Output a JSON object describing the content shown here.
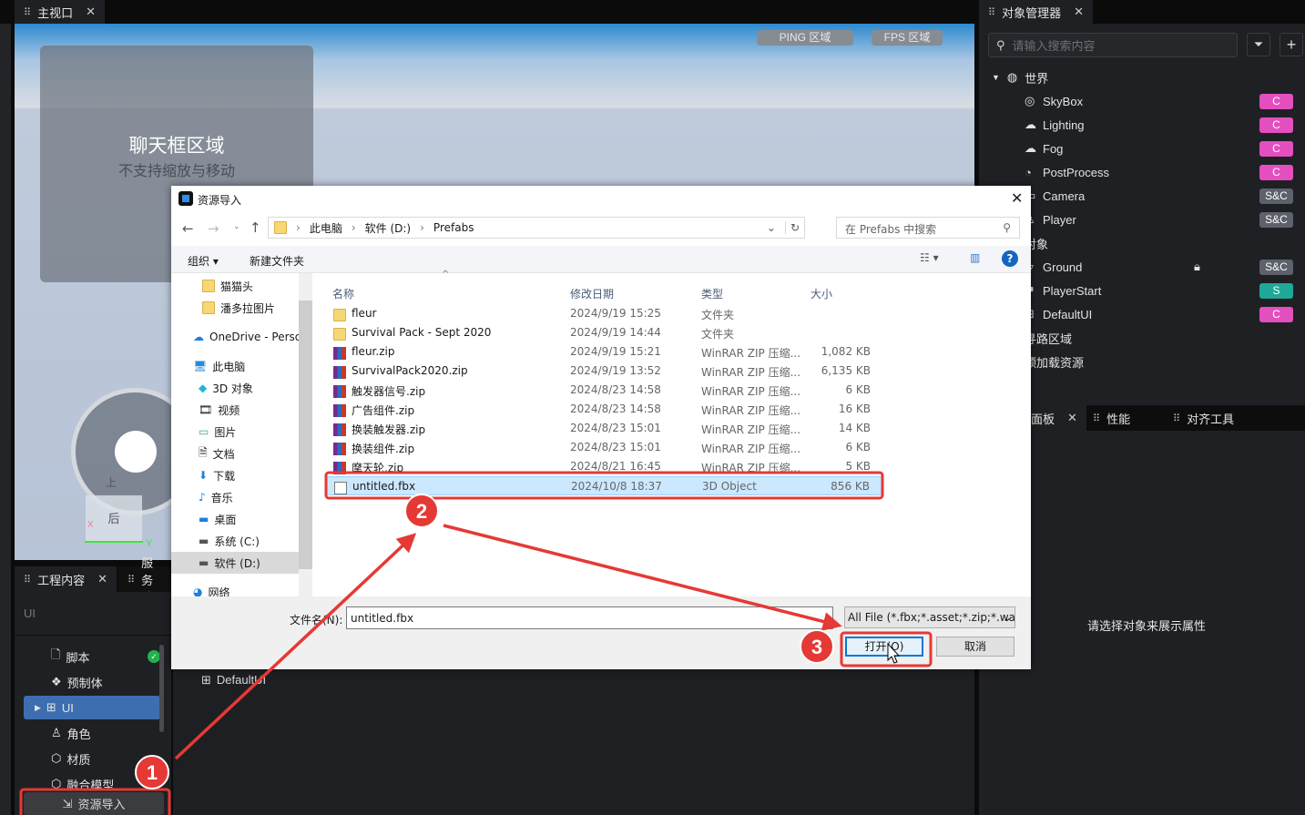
{
  "main_tab": {
    "label": "主视口"
  },
  "viewport": {
    "chat_title": "聊天框区域",
    "chat_subtitle": "不支持缩放与移动",
    "ping": "PING 区域",
    "fps": "FPS 区域",
    "joystick_up": "上",
    "joystick_back": "后",
    "axis_x": "X",
    "axis_y": "Y"
  },
  "left_panel": {
    "tabs": [
      "工程内容",
      "服务端"
    ],
    "breadcrumb": "UI",
    "items": [
      {
        "label": "脚本",
        "icon": "file-icon",
        "status": "check"
      },
      {
        "label": "预制体",
        "icon": "prefab-icon"
      },
      {
        "label": "UI",
        "icon": "ui-icon",
        "selected": true
      },
      {
        "label": "角色",
        "icon": "character-icon"
      },
      {
        "label": "材质",
        "icon": "cube-icon"
      },
      {
        "label": "融合模型",
        "icon": "model-icon"
      }
    ],
    "import_button": "资源导入",
    "content_item": "DefaultUI"
  },
  "right_panel": {
    "tab": "对象管理器",
    "search_placeholder": "请输入搜索内容",
    "world": "世界",
    "tree": [
      {
        "label": "SkyBox",
        "tag": "C"
      },
      {
        "label": "Lighting",
        "tag": "C"
      },
      {
        "label": "Fog",
        "tag": "C"
      },
      {
        "label": "PostProcess",
        "tag": "C"
      },
      {
        "label": "Camera",
        "tag": "S&C"
      },
      {
        "label": "Player",
        "tag": "S&C"
      },
      {
        "label": "对象",
        "group": true
      },
      {
        "label": "Ground",
        "tag": "S&C",
        "locked": true
      },
      {
        "label": "PlayerStart",
        "tag": "S"
      },
      {
        "label": "DefaultUI",
        "tag": "C"
      },
      {
        "label": "寻路区域",
        "group": true
      },
      {
        "label": "预加载资源",
        "group": true
      }
    ],
    "bottom_tabs": [
      "面板",
      "性能",
      "对齐工具"
    ],
    "empty_text": "请选择对象来展示属性"
  },
  "tag_colors": {
    "C": "#e44fbf",
    "S&C": "#5c616b",
    "S": "#1fa898"
  },
  "dialog": {
    "title": "资源导入",
    "path": [
      "此电脑",
      "软件 (D:)",
      "Prefabs"
    ],
    "search_placeholder": "在 Prefabs 中搜索",
    "organize": "组织",
    "new_folder": "新建文件夹",
    "nav": [
      {
        "label": "猫猫头",
        "icon": "folder"
      },
      {
        "label": "潘多拉图片",
        "icon": "folder"
      },
      {
        "label": "OneDrive - Personal",
        "icon": "cloud"
      },
      {
        "label": "此电脑",
        "icon": "pc"
      },
      {
        "label": "3D 对象",
        "icon": "3d"
      },
      {
        "label": "视频",
        "icon": "video"
      },
      {
        "label": "图片",
        "icon": "picture"
      },
      {
        "label": "文档",
        "icon": "doc"
      },
      {
        "label": "下载",
        "icon": "download"
      },
      {
        "label": "音乐",
        "icon": "music"
      },
      {
        "label": "桌面",
        "icon": "desktop"
      },
      {
        "label": "系统 (C:)",
        "icon": "drive"
      },
      {
        "label": "软件 (D:)",
        "icon": "drive",
        "selected": true
      },
      {
        "label": "网络",
        "icon": "network"
      }
    ],
    "columns": [
      "名称",
      "修改日期",
      "类型",
      "大小"
    ],
    "files": [
      {
        "name": "fleur",
        "date": "2024/9/19 15:25",
        "type": "文件夹",
        "size": "",
        "icon": "folder"
      },
      {
        "name": "Survival Pack - Sept 2020",
        "date": "2024/9/19 14:44",
        "type": "文件夹",
        "size": "",
        "icon": "folder"
      },
      {
        "name": "fleur.zip",
        "date": "2024/9/19 15:21",
        "type": "WinRAR ZIP 压缩...",
        "size": "1,082 KB",
        "icon": "rar"
      },
      {
        "name": "SurvivalPack2020.zip",
        "date": "2024/9/19 13:52",
        "type": "WinRAR ZIP 压缩...",
        "size": "6,135 KB",
        "icon": "rar"
      },
      {
        "name": "触发器信号.zip",
        "date": "2024/8/23 14:58",
        "type": "WinRAR ZIP 压缩...",
        "size": "6 KB",
        "icon": "rar"
      },
      {
        "name": "广告组件.zip",
        "date": "2024/8/23 14:58",
        "type": "WinRAR ZIP 压缩...",
        "size": "16 KB",
        "icon": "rar"
      },
      {
        "name": "换装触发器.zip",
        "date": "2024/8/23 15:01",
        "type": "WinRAR ZIP 压缩...",
        "size": "14 KB",
        "icon": "rar"
      },
      {
        "name": "换装组件.zip",
        "date": "2024/8/23 15:01",
        "type": "WinRAR ZIP 压缩...",
        "size": "6 KB",
        "icon": "rar"
      },
      {
        "name": "摩天轮.zip",
        "date": "2024/8/21 16:45",
        "type": "WinRAR ZIP 压缩...",
        "size": "5 KB",
        "icon": "rar"
      },
      {
        "name": "untitled.fbx",
        "date": "2024/10/8 18:37",
        "type": "3D Object",
        "size": "856 KB",
        "icon": "fbx",
        "selected": true
      }
    ],
    "filename_label": "文件名(N):",
    "filename": "untitled.fbx",
    "filetype": "All File (*.fbx;*.asset;*.zip;*.wa",
    "open": "打开(O)",
    "cancel": "取消"
  },
  "annotations": [
    "1",
    "2",
    "3"
  ],
  "annotation_color": "#e53935"
}
